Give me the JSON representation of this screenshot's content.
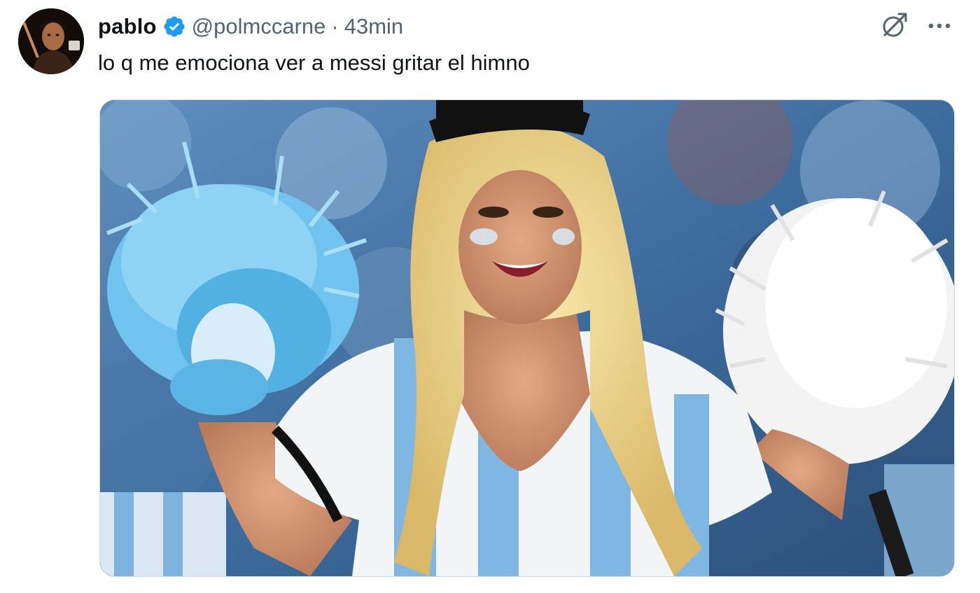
{
  "tweet": {
    "display_name": "pablo",
    "handle": "@polmccarne",
    "separator": "·",
    "timestamp": "43min",
    "text": "lo q me emociona ver a messi gritar el himno",
    "verified": true
  },
  "icons": {
    "verified": "verified-badge-icon",
    "grok": "grok-icon",
    "more": "more-options-icon"
  },
  "colors": {
    "verified_blue": "#1d9bf0",
    "text_primary": "#0f1419",
    "text_secondary": "#536471",
    "border": "#cfd9de"
  }
}
